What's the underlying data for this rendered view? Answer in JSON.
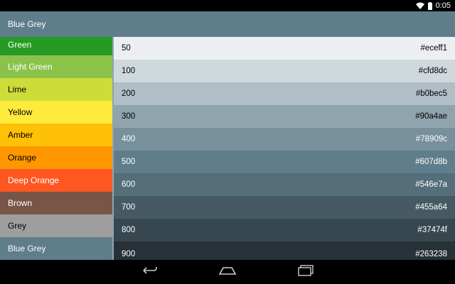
{
  "status": {
    "time": "0:05"
  },
  "header": {
    "title": "Blue Grey"
  },
  "sidebar": {
    "items": [
      {
        "label": "Green",
        "bg": "#259b24",
        "fg": "#ffffff"
      },
      {
        "label": "Light Green",
        "bg": "#8bc34a",
        "fg": "#ffffff"
      },
      {
        "label": "Lime",
        "bg": "#cddc39",
        "fg": "#000000"
      },
      {
        "label": "Yellow",
        "bg": "#ffeb3b",
        "fg": "#000000"
      },
      {
        "label": "Amber",
        "bg": "#ffc107",
        "fg": "#000000"
      },
      {
        "label": "Orange",
        "bg": "#ff9800",
        "fg": "#000000"
      },
      {
        "label": "Deep Orange",
        "bg": "#ff5722",
        "fg": "#ffffff"
      },
      {
        "label": "Brown",
        "bg": "#795548",
        "fg": "#ffffff"
      },
      {
        "label": "Grey",
        "bg": "#9e9e9e",
        "fg": "#000000"
      },
      {
        "label": "Blue Grey",
        "bg": "#607d8b",
        "fg": "#ffffff"
      }
    ]
  },
  "swatches": [
    {
      "shade": "50",
      "hex": "#eceff1",
      "fg": "#000000"
    },
    {
      "shade": "100",
      "hex": "#cfd8dc",
      "fg": "#000000"
    },
    {
      "shade": "200",
      "hex": "#b0bec5",
      "fg": "#000000"
    },
    {
      "shade": "300",
      "hex": "#90a4ae",
      "fg": "#000000"
    },
    {
      "shade": "400",
      "hex": "#78909c",
      "fg": "#ffffff"
    },
    {
      "shade": "500",
      "hex": "#607d8b",
      "fg": "#ffffff"
    },
    {
      "shade": "600",
      "hex": "#546e7a",
      "fg": "#ffffff"
    },
    {
      "shade": "700",
      "hex": "#455a64",
      "fg": "#ffffff"
    },
    {
      "shade": "800",
      "hex": "#37474f",
      "fg": "#ffffff"
    },
    {
      "shade": "900",
      "hex": "#263238",
      "fg": "#ffffff"
    }
  ],
  "icons": {
    "status": [
      "wifi-icon",
      "battery-icon"
    ],
    "nav": [
      "back-icon",
      "home-icon",
      "recents-icon"
    ]
  }
}
